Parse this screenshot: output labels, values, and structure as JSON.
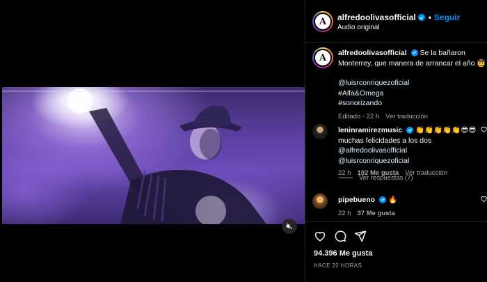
{
  "header": {
    "username": "alfredoolivasofficial",
    "separator": "•",
    "follow_label": "Seguir",
    "audio": "Audio original",
    "avatar_letter": "A"
  },
  "caption": {
    "username": "alfredoolivasofficial",
    "text_line1": "Se la bañaron",
    "text_line2": "Monterrey, que manera de arrancar el año 🤠",
    "mention": "@luisrconriquezoficial",
    "hashtag1": "#Alfa&Omega",
    "hashtag2": "#sonorizando",
    "edited_time": "Editado · 22 h",
    "see_translation": "Ver traducción"
  },
  "comments": [
    {
      "username": "leninramirezmusic",
      "emojis": "👏👏👏👏👏😎😎",
      "text_a": "muchas felicidades a los dos ",
      "mention1": "@alfredoolivasofficial",
      "mention2": "@luisrconriquezoficial",
      "time": "22 h",
      "likes": "102 Me gusta",
      "see_translation": "Ver traducción"
    },
    {
      "username": "pipebueno",
      "text": "🔥",
      "time": "22 h",
      "likes": "37 Me gusta"
    }
  ],
  "replies": {
    "label": "Ver respuestas (7)"
  },
  "footer": {
    "likes": "94.396 Me gusta",
    "posted": "HACE 22 HORAS"
  },
  "icons": {
    "like": "heart-icon",
    "comment": "comment-icon",
    "share": "share-icon",
    "mute": "volume-muted-icon",
    "verified": "verified-badge-icon"
  },
  "colors": {
    "accent": "#0095f6",
    "muted": "#a8a8a8",
    "divider": "#262626",
    "background": "#000000"
  }
}
